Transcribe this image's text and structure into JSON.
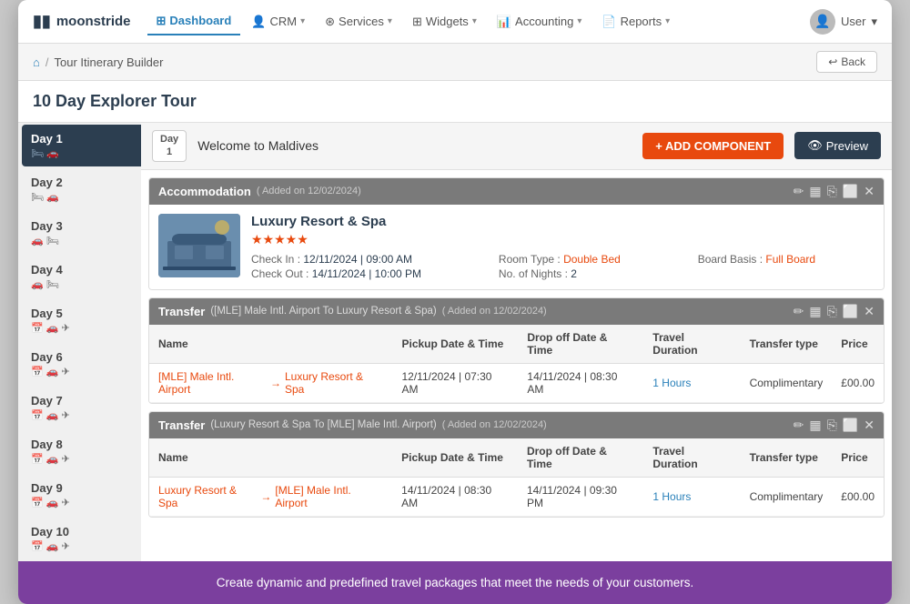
{
  "app": {
    "logo_text": "moonstride",
    "logo_icon": "&#9646;&#9646;"
  },
  "nav": {
    "dashboard_label": "Dashboard",
    "crm_label": "CRM",
    "services_label": "Services",
    "widgets_label": "Widgets",
    "accounting_label": "Accounting",
    "reports_label": "Reports",
    "user_label": "User"
  },
  "breadcrumb": {
    "home_icon": "⌂",
    "separator": "/",
    "section": "Tour Itinerary Builder",
    "back_label": "Back"
  },
  "page": {
    "title": "10 Day Explorer Tour"
  },
  "days": [
    {
      "id": "day1",
      "label": "Day 1",
      "icons": "🛏 🚗",
      "active": true
    },
    {
      "id": "day2",
      "label": "Day 2",
      "icons": "🛏 🚗"
    },
    {
      "id": "day3",
      "label": "Day 3",
      "icons": "🚗 🛏"
    },
    {
      "id": "day4",
      "label": "Day 4",
      "icons": "🚗 🛏"
    },
    {
      "id": "day5",
      "label": "Day 5",
      "icons": "📅 🚗 ✈"
    },
    {
      "id": "day6",
      "label": "Day 6",
      "icons": "📅 🚗 ✈"
    },
    {
      "id": "day7",
      "label": "Day 7",
      "icons": "📅 🚗 ✈"
    },
    {
      "id": "day8",
      "label": "Day 8",
      "icons": "📅 🚗 ✈"
    },
    {
      "id": "day9",
      "label": "Day 9",
      "icons": "📅 🚗 ✈"
    },
    {
      "id": "day10",
      "label": "Day 10",
      "icons": "📅 🚗 ✈"
    }
  ],
  "day_content": {
    "day_badge_line1": "Day",
    "day_badge_line2": "1",
    "day_title": "Welcome to Maldives",
    "add_component_label": "+ ADD COMPONENT",
    "preview_label": "Preview",
    "preview_icon": "👁"
  },
  "accommodation": {
    "section_title": "Accommodation",
    "added_text": "( Added on 12/02/2024)",
    "hotel_name": "Luxury Resort & Spa",
    "stars": "★★★★★",
    "check_in_label": "Check In :",
    "check_in_value": "12/11/2024 | 09:00 AM",
    "check_out_label": "Check Out :",
    "check_out_value": "14/11/2024 | 10:00 PM",
    "room_type_label": "Room Type :",
    "room_type_value": "Double Bed",
    "nights_label": "No. of Nights :",
    "nights_value": "2",
    "board_basis_label": "Board Basis :",
    "board_basis_value": "Full Board"
  },
  "transfer1": {
    "section_title": "Transfer",
    "section_subtitle": "([MLE] Male Intl. Airport To Luxury Resort & Spa)",
    "added_text": "( Added on 12/02/2024)",
    "columns": [
      "Name",
      "Pickup Date & Time",
      "Drop off Date & Time",
      "Travel Duration",
      "Transfer type",
      "Price"
    ],
    "rows": [
      {
        "name_from": "[MLE] Male Intl. Airport",
        "name_to": "Luxury Resort & Spa",
        "pickup": "12/11/2024 | 07:30 AM",
        "dropoff": "14/11/2024 | 08:30 AM",
        "duration": "1 Hours",
        "transfer_type": "Complimentary",
        "price": "£00.00"
      }
    ]
  },
  "transfer2": {
    "section_title": "Transfer",
    "section_subtitle": "(Luxury Resort & Spa To [MLE] Male Intl. Airport)",
    "added_text": "( Added on 12/02/2024)",
    "columns": [
      "Name",
      "Pickup Date & Time",
      "Drop off Date & Time",
      "Travel Duration",
      "Transfer type",
      "Price"
    ],
    "rows": [
      {
        "name_from": "Luxury Resort & Spa",
        "name_to": "[MLE] Male Intl. Airport",
        "pickup": "14/11/2024 | 08:30 AM",
        "dropoff": "14/11/2024 | 09:30 PM",
        "duration": "1 Hours",
        "transfer_type": "Complimentary",
        "price": "£00.00"
      }
    ]
  },
  "footer": {
    "banner_text": "Create dynamic and predefined travel packages that meet the needs of your customers."
  },
  "icons": {
    "edit": "✏",
    "grid": "▦",
    "copy": "⎘",
    "expand": "⬜",
    "close": "✕",
    "back_arrow": "↩",
    "home": "⌂",
    "eye": "👁",
    "arrow_right": "→"
  }
}
